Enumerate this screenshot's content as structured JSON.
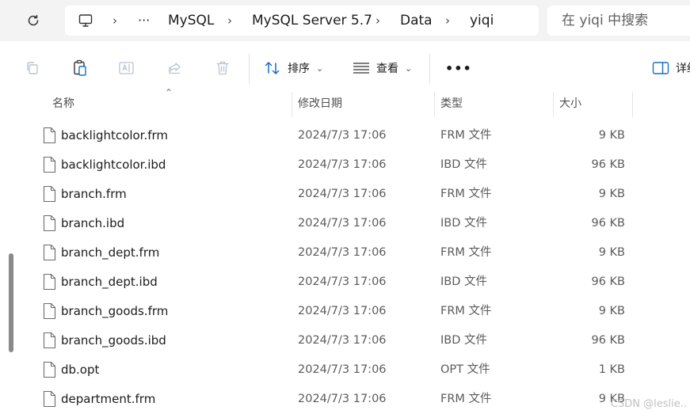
{
  "breadcrumb": [
    "MySQL",
    "MySQL Server 5.7",
    "Data",
    "yiqi"
  ],
  "breadcrumb_more": "···",
  "search": {
    "placeholder": "在 yiqi 中搜索"
  },
  "toolbar": {
    "sort_label": "排序",
    "view_label": "查看",
    "more_label": "•••",
    "details_label": "详细"
  },
  "columns": {
    "name": "名称",
    "date": "修改日期",
    "type": "类型",
    "size": "大小"
  },
  "files": [
    {
      "name": "backlightcolor.frm",
      "date": "2024/7/3 17:06",
      "type": "FRM 文件",
      "size": "9 KB"
    },
    {
      "name": "backlightcolor.ibd",
      "date": "2024/7/3 17:06",
      "type": "IBD 文件",
      "size": "96 KB"
    },
    {
      "name": "branch.frm",
      "date": "2024/7/3 17:06",
      "type": "FRM 文件",
      "size": "9 KB"
    },
    {
      "name": "branch.ibd",
      "date": "2024/7/3 17:06",
      "type": "IBD 文件",
      "size": "96 KB"
    },
    {
      "name": "branch_dept.frm",
      "date": "2024/7/3 17:06",
      "type": "FRM 文件",
      "size": "9 KB"
    },
    {
      "name": "branch_dept.ibd",
      "date": "2024/7/3 17:06",
      "type": "IBD 文件",
      "size": "96 KB"
    },
    {
      "name": "branch_goods.frm",
      "date": "2024/7/3 17:06",
      "type": "FRM 文件",
      "size": "9 KB"
    },
    {
      "name": "branch_goods.ibd",
      "date": "2024/7/3 17:06",
      "type": "IBD 文件",
      "size": "96 KB"
    },
    {
      "name": "db.opt",
      "date": "2024/7/3 17:06",
      "type": "OPT 文件",
      "size": "1 KB"
    },
    {
      "name": "department.frm",
      "date": "2024/7/3 17:06",
      "type": "FRM 文件",
      "size": "9 KB"
    }
  ],
  "watermark": "CSDN @leslie..",
  "icons": [
    "refresh-icon",
    "computer-icon",
    "copy-icon",
    "paste-icon",
    "rename-icon",
    "share-icon",
    "delete-icon",
    "sort-icon",
    "view-icon",
    "details-pane-icon",
    "file-icon"
  ]
}
